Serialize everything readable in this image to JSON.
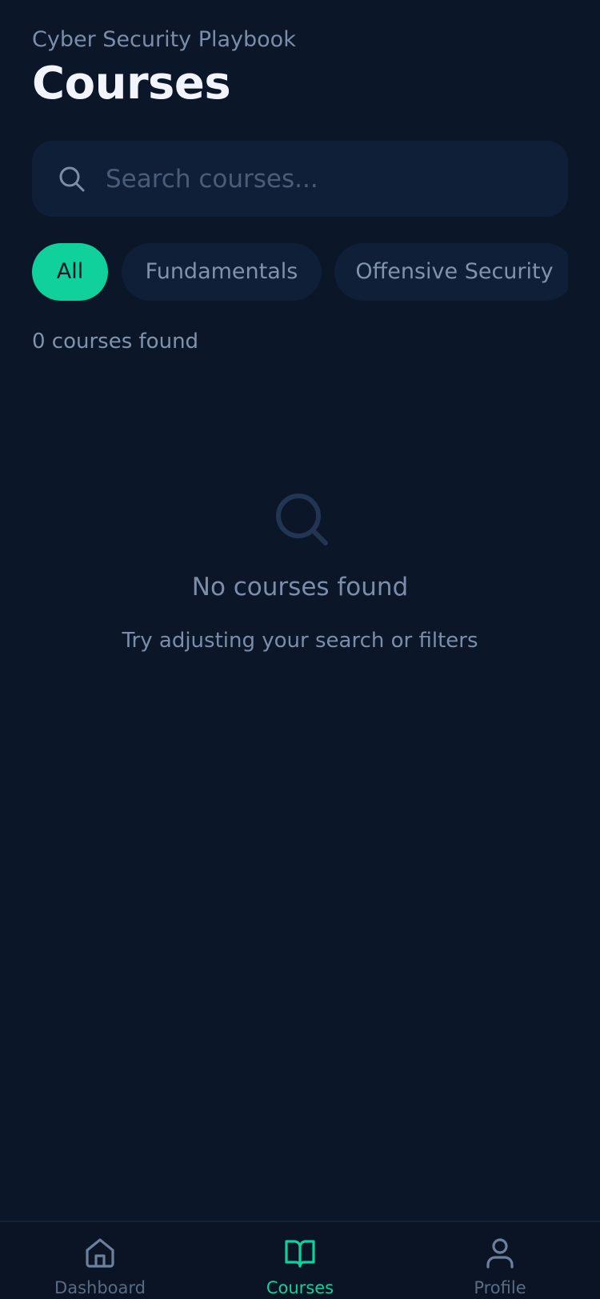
{
  "header": {
    "subtitle": "Cyber Security Playbook",
    "title": "Courses"
  },
  "search": {
    "placeholder": "Search courses...",
    "value": "",
    "icon": "search-icon"
  },
  "filters": [
    {
      "label": "All",
      "active": true
    },
    {
      "label": "Fundamentals",
      "active": false
    },
    {
      "label": "Offensive Security",
      "active": false
    }
  ],
  "results": {
    "count_text": "0 courses found"
  },
  "empty_state": {
    "icon": "search-icon",
    "title": "No courses found",
    "subtitle": "Try adjusting your search or filters"
  },
  "tabbar": {
    "items": [
      {
        "label": "Dashboard",
        "icon": "home-icon",
        "active": false
      },
      {
        "label": "Courses",
        "icon": "book-icon",
        "active": true
      },
      {
        "label": "Profile",
        "icon": "user-icon",
        "active": false
      }
    ]
  },
  "colors": {
    "background": "#0b1628",
    "surface": "#0f1f37",
    "accent": "#10d09b",
    "text_primary": "#f1f5fb",
    "text_muted": "#7b8da8"
  }
}
